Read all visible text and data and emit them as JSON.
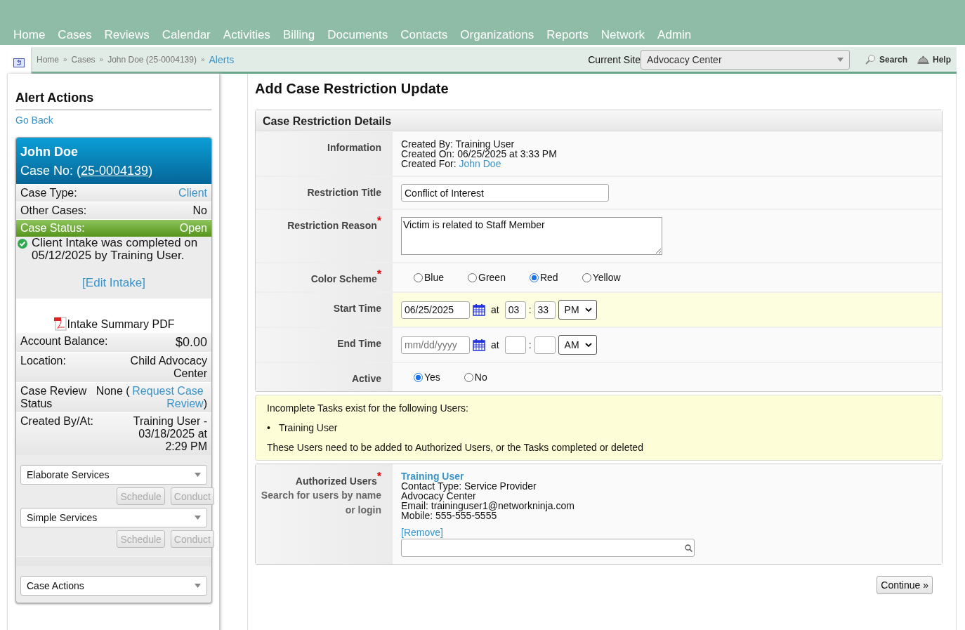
{
  "nav": {
    "items": [
      "Home",
      "Cases",
      "Reviews",
      "Calendar",
      "Activities",
      "Billing",
      "Documents",
      "Contacts",
      "Organizations",
      "Reports",
      "Network",
      "Admin"
    ]
  },
  "breadcrumb": {
    "separator": "»",
    "items": [
      {
        "label": "Home",
        "active": false
      },
      {
        "label": "Cases",
        "active": false
      },
      {
        "label": "John Doe (25-0004139)",
        "active": false
      },
      {
        "label": "Alerts",
        "active": true
      }
    ]
  },
  "site": {
    "label": "Current Site",
    "value": "Advocacy Center"
  },
  "tools": [
    {
      "kind": "search",
      "label": "Search"
    },
    {
      "kind": "help",
      "label": "Help"
    }
  ],
  "sidebar": {
    "title": "Alert Actions",
    "back_link": "Go Back",
    "card": {
      "name": "John Doe",
      "case_no_prefix": "Case No: (",
      "case_no": "25-0004139",
      "case_no_suffix": ")",
      "rows": [
        {
          "kind": "link",
          "label": "Case Type:",
          "value": "Client"
        },
        {
          "kind": "plain",
          "label": "Other Cases:",
          "value": "No"
        },
        {
          "kind": "status",
          "label": "Case Status:",
          "value": "Open"
        }
      ],
      "intake_note": "Client Intake was completed on 05/12/2025 by Training User.",
      "edit_link": "[Edit Intake]",
      "pdf": "Intake Summary PDF",
      "details": [
        {
          "kind": "balance",
          "label": "Account Balance:",
          "value": "$0.00"
        },
        {
          "kind": "plain",
          "label": "Location:",
          "value": "Child Advocacy Center"
        },
        {
          "kind": "review",
          "label": "Case Review Status",
          "value": "None (",
          "link": "Request Case Review",
          "suffix": ")"
        },
        {
          "kind": "plain",
          "label": "Created By/At:",
          "value": "Training User - 03/18/2025 at 2:29 PM"
        }
      ],
      "services": [
        {
          "select": "Elaborate Services",
          "buttons": [
            {
              "label": "Schedule",
              "disabled": true
            },
            {
              "label": "Conduct",
              "disabled": true
            }
          ]
        },
        {
          "select": "Simple Services",
          "buttons": [
            {
              "label": "Schedule",
              "disabled": true
            },
            {
              "label": "Conduct",
              "disabled": true
            }
          ]
        }
      ],
      "case_actions": "Case Actions"
    }
  },
  "main": {
    "title": "Add Case Restriction Update",
    "section": "Case Restriction Details",
    "rows": [
      {
        "kind": "info",
        "label": "Information",
        "lines": [
          {
            "label": "Created By:",
            "value": "Training User",
            "link": false
          },
          {
            "label": "Created On:",
            "value": "06/25/2025 at 3:33 PM",
            "link": false
          },
          {
            "label": "Created For:",
            "value": "John Doe",
            "link": true
          }
        ]
      },
      {
        "kind": "text",
        "label": "Restriction Title",
        "value": "Conflict of Interest"
      },
      {
        "kind": "textarea",
        "label": "Restriction Reason",
        "required_mark": "*",
        "value": "Victim is related to Staff Member"
      },
      {
        "kind": "radio",
        "label": "Color Scheme",
        "required_mark": "*",
        "options": [
          {
            "label": "Blue",
            "selected": false
          },
          {
            "label": "Green",
            "selected": false
          },
          {
            "label": "Red",
            "selected": true
          },
          {
            "label": "Yellow",
            "selected": false
          }
        ]
      },
      {
        "kind": "datetime",
        "label": "Start Time",
        "highlighted": true,
        "date": "06/25/2025",
        "at": "at",
        "hour": "03",
        "colon": ":",
        "minute": "33",
        "ampm": "PM"
      },
      {
        "kind": "datetime",
        "label": "End Time",
        "highlighted": false,
        "date_placeholder": "mm/dd/yyyy",
        "at": "at",
        "colon": ":",
        "ampm": "AM"
      },
      {
        "kind": "radio",
        "label": "Active",
        "options": [
          {
            "label": "Yes",
            "selected": true
          },
          {
            "label": "No",
            "selected": false
          }
        ]
      }
    ],
    "alert": {
      "heading": "Incomplete Tasks exist for the following Users:",
      "bullet": "•",
      "items": [
        "Training User"
      ],
      "footer": "These Users need to be added to Authorized Users, or the Tasks completed or deleted"
    },
    "users": {
      "label": "Authorized Users",
      "required_mark": "*",
      "hint": "Search for users by name or login",
      "name": "Training User",
      "lines": [
        "Contact Type: Service Provider",
        "Advocacy Center",
        "Email: traininguser1@networkninja.com",
        "Mobile: 555-555-5555"
      ],
      "remove": "[Remove]"
    },
    "continue": "Continue »"
  }
}
